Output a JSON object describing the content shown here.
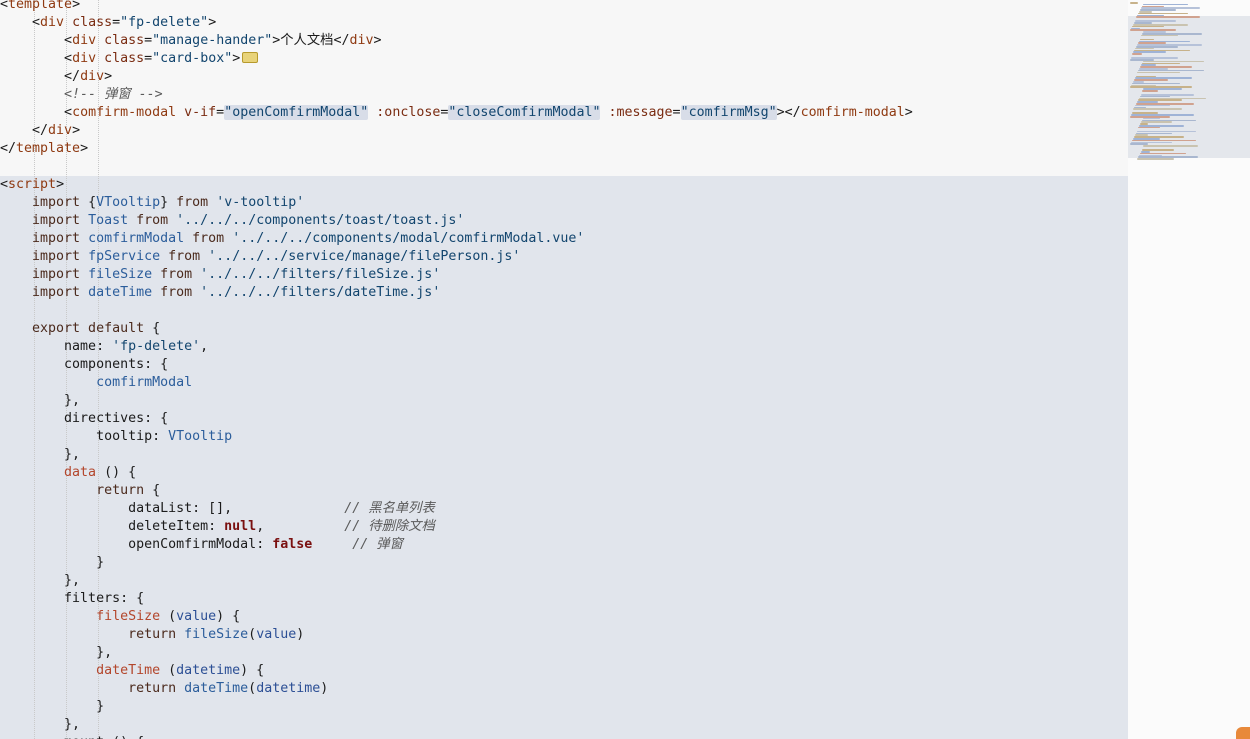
{
  "editor": {
    "lines": [
      [
        {
          "t": "<",
          "c": "pun"
        },
        {
          "t": "template",
          "c": "tag"
        },
        {
          "t": ">",
          "c": "pun"
        }
      ],
      [
        {
          "t": "    <",
          "c": "pun"
        },
        {
          "t": "div",
          "c": "tag"
        },
        {
          "t": " class",
          "c": "attr"
        },
        {
          "t": "=",
          "c": "pun"
        },
        {
          "t": "\"fp-delete\"",
          "c": "str"
        },
        {
          "t": ">",
          "c": "pun"
        }
      ],
      [
        {
          "t": "        <",
          "c": "pun"
        },
        {
          "t": "div",
          "c": "tag"
        },
        {
          "t": " class",
          "c": "attr"
        },
        {
          "t": "=",
          "c": "pun"
        },
        {
          "t": "\"manage-hander\"",
          "c": "str"
        },
        {
          "t": ">",
          "c": "pun"
        },
        {
          "t": "个人文档",
          "c": "txt"
        },
        {
          "t": "</",
          "c": "pun"
        },
        {
          "t": "div",
          "c": "tag"
        },
        {
          "t": ">",
          "c": "pun"
        }
      ],
      [
        {
          "t": "        <",
          "c": "pun"
        },
        {
          "t": "div",
          "c": "tag"
        },
        {
          "t": " class",
          "c": "attr"
        },
        {
          "t": "=",
          "c": "pun"
        },
        {
          "t": "\"card-box\"",
          "c": "str"
        },
        {
          "t": ">",
          "c": "pun"
        },
        {
          "t": "",
          "c": "fold"
        }
      ],
      [
        {
          "t": "        </",
          "c": "pun"
        },
        {
          "t": "div",
          "c": "tag"
        },
        {
          "t": ">",
          "c": "pun"
        }
      ],
      [
        {
          "t": "        <!-- 弹窗 -->",
          "c": "comment"
        }
      ],
      [
        {
          "t": "        <",
          "c": "pun"
        },
        {
          "t": "comfirm-modal",
          "c": "tag"
        },
        {
          "t": " v-if",
          "c": "attr"
        },
        {
          "t": "=",
          "c": "pun"
        },
        {
          "t": "\"openComfirmModal\"",
          "c": "str",
          "hl": true
        },
        {
          "t": " :onclose",
          "c": "attr"
        },
        {
          "t": "=",
          "c": "pun"
        },
        {
          "t": "\"closeComfirmModal\"",
          "c": "str",
          "hl": true
        },
        {
          "t": " :message",
          "c": "attr"
        },
        {
          "t": "=",
          "c": "pun"
        },
        {
          "t": "\"comfirmMsg\"",
          "c": "str",
          "hl": true
        },
        {
          "t": "></",
          "c": "pun"
        },
        {
          "t": "comfirm-modal",
          "c": "tag"
        },
        {
          "t": ">",
          "c": "pun"
        }
      ],
      [
        {
          "t": "    </",
          "c": "pun"
        },
        {
          "t": "div",
          "c": "tag"
        },
        {
          "t": ">",
          "c": "pun"
        }
      ],
      [
        {
          "t": "</",
          "c": "pun"
        },
        {
          "t": "template",
          "c": "tag"
        },
        {
          "t": ">",
          "c": "pun"
        }
      ],
      [],
      [
        {
          "t": "<",
          "c": "pun"
        },
        {
          "t": "script",
          "c": "tag"
        },
        {
          "t": ">",
          "c": "pun"
        }
      ],
      [
        {
          "t": "    import ",
          "c": "kw"
        },
        {
          "t": "{",
          "c": "pun"
        },
        {
          "t": "VTooltip",
          "c": "ident"
        },
        {
          "t": "}",
          "c": "pun"
        },
        {
          "t": " from ",
          "c": "kw"
        },
        {
          "t": "'v-tooltip'",
          "c": "str"
        }
      ],
      [
        {
          "t": "    import ",
          "c": "kw"
        },
        {
          "t": "Toast",
          "c": "ident"
        },
        {
          "t": " from ",
          "c": "kw"
        },
        {
          "t": "'../../../components/toast/toast.js'",
          "c": "str"
        }
      ],
      [
        {
          "t": "    import ",
          "c": "kw"
        },
        {
          "t": "comfirmModal",
          "c": "ident"
        },
        {
          "t": " from ",
          "c": "kw"
        },
        {
          "t": "'../../../components/modal/comfirmModal.vue'",
          "c": "str"
        }
      ],
      [
        {
          "t": "    import ",
          "c": "kw"
        },
        {
          "t": "fpService",
          "c": "ident"
        },
        {
          "t": " from ",
          "c": "kw"
        },
        {
          "t": "'../../../service/manage/filePerson.js'",
          "c": "str"
        }
      ],
      [
        {
          "t": "    import ",
          "c": "kw"
        },
        {
          "t": "fileSize",
          "c": "ident"
        },
        {
          "t": " from ",
          "c": "kw"
        },
        {
          "t": "'../../../filters/fileSize.js'",
          "c": "str"
        }
      ],
      [
        {
          "t": "    import ",
          "c": "kw"
        },
        {
          "t": "dateTime",
          "c": "ident"
        },
        {
          "t": " from ",
          "c": "kw"
        },
        {
          "t": "'../../../filters/dateTime.js'",
          "c": "str"
        }
      ],
      [],
      [
        {
          "t": "    export default ",
          "c": "kw"
        },
        {
          "t": "{",
          "c": "pun"
        }
      ],
      [
        {
          "t": "        name",
          "c": "txt"
        },
        {
          "t": ": ",
          "c": "pun"
        },
        {
          "t": "'fp-delete'",
          "c": "str"
        },
        {
          "t": ",",
          "c": "pun"
        }
      ],
      [
        {
          "t": "        components",
          "c": "txt"
        },
        {
          "t": ": {",
          "c": "pun"
        }
      ],
      [
        {
          "t": "            comfirmModal",
          "c": "ident"
        }
      ],
      [
        {
          "t": "        },",
          "c": "pun"
        }
      ],
      [
        {
          "t": "        directives",
          "c": "txt"
        },
        {
          "t": ": {",
          "c": "pun"
        }
      ],
      [
        {
          "t": "            tooltip",
          "c": "txt"
        },
        {
          "t": ": ",
          "c": "pun"
        },
        {
          "t": "VTooltip",
          "c": "ident"
        }
      ],
      [
        {
          "t": "        },",
          "c": "pun"
        }
      ],
      [
        {
          "t": "        data",
          "c": "fn"
        },
        {
          "t": " () {",
          "c": "pun"
        }
      ],
      [
        {
          "t": "            return ",
          "c": "kw"
        },
        {
          "t": "{",
          "c": "pun"
        }
      ],
      [
        {
          "t": "                dataList",
          "c": "txt"
        },
        {
          "t": ": [],              ",
          "c": "pun"
        },
        {
          "t": "// 黑名单列表",
          "c": "comment"
        }
      ],
      [
        {
          "t": "                deleteItem",
          "c": "txt"
        },
        {
          "t": ": ",
          "c": "pun"
        },
        {
          "t": "null",
          "c": "bool"
        },
        {
          "t": ",          ",
          "c": "pun"
        },
        {
          "t": "// 待删除文档",
          "c": "comment"
        }
      ],
      [
        {
          "t": "                openComfirmModal",
          "c": "txt"
        },
        {
          "t": ": ",
          "c": "pun"
        },
        {
          "t": "false",
          "c": "bool"
        },
        {
          "t": "     ",
          "c": "pun"
        },
        {
          "t": "// 弹窗",
          "c": "comment"
        }
      ],
      [
        {
          "t": "            }",
          "c": "pun"
        }
      ],
      [
        {
          "t": "        },",
          "c": "pun"
        }
      ],
      [
        {
          "t": "        filters",
          "c": "txt"
        },
        {
          "t": ": {",
          "c": "pun"
        }
      ],
      [
        {
          "t": "            fileSize",
          "c": "fn"
        },
        {
          "t": " (",
          "c": "pun"
        },
        {
          "t": "value",
          "c": "sym"
        },
        {
          "t": ") {",
          "c": "pun"
        }
      ],
      [
        {
          "t": "                return ",
          "c": "kw"
        },
        {
          "t": "fileSize",
          "c": "ident"
        },
        {
          "t": "(",
          "c": "pun"
        },
        {
          "t": "value",
          "c": "sym"
        },
        {
          "t": ")",
          "c": "pun"
        }
      ],
      [
        {
          "t": "            },",
          "c": "pun"
        }
      ],
      [
        {
          "t": "            dateTime",
          "c": "fn"
        },
        {
          "t": " (",
          "c": "pun"
        },
        {
          "t": "datetime",
          "c": "sym"
        },
        {
          "t": ") {",
          "c": "pun"
        }
      ],
      [
        {
          "t": "                return ",
          "c": "kw"
        },
        {
          "t": "dateTime",
          "c": "ident"
        },
        {
          "t": "(",
          "c": "pun"
        },
        {
          "t": "datetime",
          "c": "sym"
        },
        {
          "t": ")",
          "c": "pun"
        }
      ],
      [
        {
          "t": "            }",
          "c": "pun"
        }
      ],
      [
        {
          "t": "        },",
          "c": "pun"
        }
      ],
      [
        {
          "t": "        mount () {",
          "c": "pun"
        }
      ]
    ]
  },
  "colors": {
    "template_bg": "#f7f7f7",
    "script_bg": "#e1e5ec",
    "tag": "#8f3a12",
    "string": "#12456e",
    "keyword": "#4b2a1d",
    "identifier": "#2b5d9b",
    "bool": "#7a1010",
    "comment": "#5a5a5a",
    "accent_orange": "#e8893a"
  },
  "icons": {
    "fold": "fold-badge-icon",
    "corner": "corner-tab-icon"
  }
}
